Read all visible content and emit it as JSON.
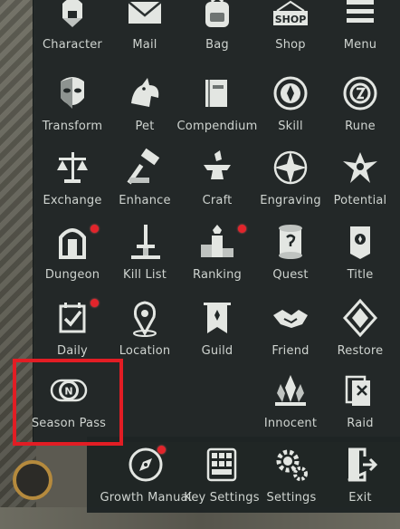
{
  "menu": {
    "row1": [
      "Character",
      "Mail",
      "Bag",
      "Shop",
      "Menu"
    ],
    "row2": [
      "Transform",
      "Pet",
      "Compendium",
      "Skill",
      "Rune"
    ],
    "row3": [
      "Exchange",
      "Enhance",
      "Craft",
      "Engraving",
      "Potential"
    ],
    "row4": [
      "Dungeon",
      "Kill List",
      "Ranking",
      "Quest",
      "Title"
    ],
    "row5": [
      "Daily",
      "Location",
      "Guild",
      "Friend",
      "Restore"
    ],
    "row6": [
      "Season Pass",
      "Innocent",
      "Raid"
    ],
    "bottom": [
      "Growth Manual",
      "Key Settings",
      "Settings",
      "Exit"
    ],
    "shop_sign": "SHOP",
    "season_badge": "N"
  },
  "colors": {
    "panel": "#212727",
    "icon": "#e3e6e2",
    "notification": "#e3242b",
    "highlight": "#e21d24"
  }
}
